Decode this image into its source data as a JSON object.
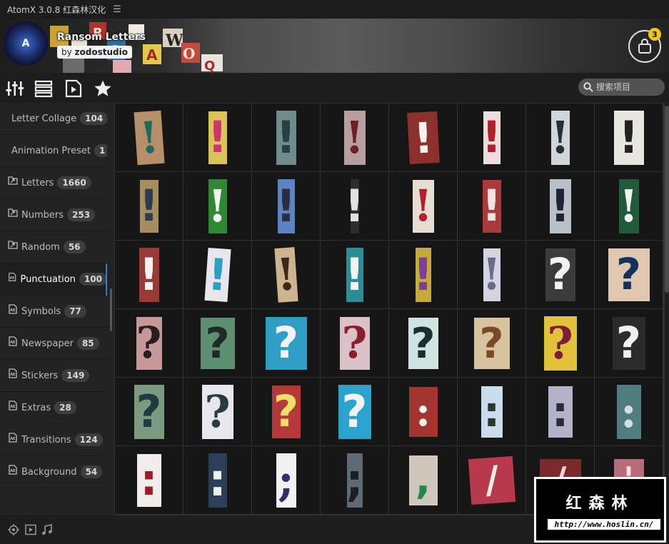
{
  "window": {
    "title": "AtomX 3.0.8 红森林汉化"
  },
  "banner": {
    "logo_letter": "A",
    "pack_title": "Ransom Letters",
    "author_prefix": "by",
    "author_name": "zodostudio",
    "cart_count": "3",
    "collage_letters": [
      "A",
      "W",
      "O",
      "Q",
      "R",
      "S",
      "E"
    ]
  },
  "toolbar": {
    "search_placeholder": "搜索项目",
    "buttons": [
      "sliders-icon",
      "list-icon",
      "play-file-icon",
      "star-icon"
    ]
  },
  "sidebar": {
    "items": [
      {
        "label": "Letter Collage",
        "count": "104",
        "icon": "ae-file-icon"
      },
      {
        "label": "Animation Preset",
        "count": "1",
        "icon": "document-icon"
      },
      {
        "label": "Letters",
        "count": "1660",
        "icon": "folder-link-icon"
      },
      {
        "label": "Numbers",
        "count": "253",
        "icon": "folder-link-icon"
      },
      {
        "label": "Random",
        "count": "56",
        "icon": "folder-link-icon"
      },
      {
        "label": "Punctuation",
        "count": "100",
        "icon": "ae-file-icon",
        "active": true
      },
      {
        "label": "Symbols",
        "count": "77",
        "icon": "ae-file-icon"
      },
      {
        "label": "Newspaper",
        "count": "85",
        "icon": "ae-file-icon"
      },
      {
        "label": "Stickers",
        "count": "149",
        "icon": "ae-file-icon"
      },
      {
        "label": "Extras",
        "count": "28",
        "icon": "ae-file-icon"
      },
      {
        "label": "Transitions",
        "count": "124",
        "icon": "ae-file-icon"
      },
      {
        "label": "Background",
        "count": "54",
        "icon": "ae-file-icon"
      }
    ]
  },
  "grid": {
    "items": [
      {
        "ch": "!",
        "bg": "#b58f68",
        "fg": "#1f6a5e"
      },
      {
        "ch": "!",
        "bg": "#d9c35a",
        "fg": "#d1336e"
      },
      {
        "ch": "!",
        "bg": "#6f8b8c",
        "fg": "#27413f"
      },
      {
        "ch": "!",
        "bg": "#b99ea1",
        "fg": "#6d1f22"
      },
      {
        "ch": "!",
        "bg": "#8d2f2a",
        "fg": "#f2f2f2"
      },
      {
        "ch": "!",
        "bg": "#ecdede",
        "fg": "#b3202c"
      },
      {
        "ch": "!",
        "bg": "#cfd6d8",
        "fg": "#263034"
      },
      {
        "ch": "!",
        "bg": "#e8e6e1",
        "fg": "#222"
      },
      {
        "ch": "!",
        "bg": "#a58d5e",
        "fg": "#2d3c50"
      },
      {
        "ch": "!",
        "bg": "#2e8a32",
        "fg": "#f4f4f4"
      },
      {
        "ch": "!",
        "bg": "#5b83c3",
        "fg": "#2b2f3c"
      },
      {
        "ch": "!",
        "bg": "#2d2d2d",
        "fg": "#e1e1e1"
      },
      {
        "ch": "!",
        "bg": "#e6ddd2",
        "fg": "#b3202c"
      },
      {
        "ch": "!",
        "bg": "#a73c3a",
        "fg": "#f0e3e3"
      },
      {
        "ch": "!",
        "bg": "#b9c1c8",
        "fg": "#223"
      },
      {
        "ch": "!",
        "bg": "#1f5a3b",
        "fg": "#f2f2f2"
      },
      {
        "ch": "!",
        "bg": "#993a34",
        "fg": "#f2f2f2"
      },
      {
        "ch": "!",
        "bg": "#e6e6ec",
        "fg": "#2f9ec4"
      },
      {
        "ch": "!",
        "bg": "#cdb48e",
        "fg": "#3a2a1d"
      },
      {
        "ch": "!",
        "bg": "#2c8c96",
        "fg": "#f2f2f2"
      },
      {
        "ch": "!",
        "bg": "#c7a83a",
        "fg": "#7a3e9f"
      },
      {
        "ch": "!",
        "bg": "#d4d4e0",
        "fg": "#6a6a8a"
      },
      {
        "ch": "?",
        "bg": "#3b3b3b",
        "fg": "#f2f2f2"
      },
      {
        "ch": "?",
        "bg": "#dfc8b0",
        "fg": "#14315c"
      },
      {
        "ch": "?",
        "bg": "#c7989a",
        "fg": "#2a1d1d"
      },
      {
        "ch": "?",
        "bg": "#5d8f72",
        "fg": "#1e2a24"
      },
      {
        "ch": "?",
        "bg": "#2f9ec4",
        "fg": "#f4f4f4"
      },
      {
        "ch": "?",
        "bg": "#d8c2c8",
        "fg": "#8a1f2b"
      },
      {
        "ch": "?",
        "bg": "#cfe3e0",
        "fg": "#1c2d2d"
      },
      {
        "ch": "?",
        "bg": "#d8c3a0",
        "fg": "#7a4a22"
      },
      {
        "ch": "?",
        "bg": "#e1c23a",
        "fg": "#7c1d3d"
      },
      {
        "ch": "?",
        "bg": "#2b2b2b",
        "fg": "#f0f0f0"
      },
      {
        "ch": "?",
        "bg": "#7b9b80",
        "fg": "#1f3a40"
      },
      {
        "ch": "?",
        "bg": "#e8e8ec",
        "fg": "#2a3b3d"
      },
      {
        "ch": "?",
        "bg": "#b43a3a",
        "fg": "#f0dd6a"
      },
      {
        "ch": "?",
        "bg": "#2aa4cf",
        "fg": "#f4f4f4"
      },
      {
        "ch": ":",
        "bg": "#a3352e",
        "fg": "#f2f2f2"
      },
      {
        "ch": ":",
        "bg": "#c9dceb",
        "fg": "#2a3a2a"
      },
      {
        "ch": ":",
        "bg": "#b4b2c8",
        "fg": "#2a2a3a"
      },
      {
        "ch": ":",
        "bg": "#4f7d7f",
        "fg": "#cfe0e0"
      },
      {
        "ch": ":",
        "bg": "#f1ecec",
        "fg": "#9e1d23"
      },
      {
        "ch": ":",
        "bg": "#2c3f58",
        "fg": "#f0f0f0"
      },
      {
        "ch": ";",
        "bg": "#f1f1f1",
        "fg": "#3a2a6a"
      },
      {
        "ch": ";",
        "bg": "#5f6b74",
        "fg": "#1a1f23"
      },
      {
        "ch": ",",
        "bg": "#cfc7bc",
        "fg": "#1f8a4a"
      },
      {
        "ch": "/",
        "bg": "#b73a4c",
        "fg": "#f2ede6"
      },
      {
        "ch": "/",
        "bg": "#7b2a2a",
        "fg": "#f3d2dc"
      },
      {
        "ch": "'",
        "bg": "#b86b78",
        "fg": "#f4e4ea"
      }
    ]
  },
  "bottombar": {
    "buttons": [
      "target-icon",
      "play-box-icon",
      "music-note-icon"
    ]
  },
  "watermark": {
    "title": "红森林",
    "url": "http://www.hoslin.cn/"
  }
}
